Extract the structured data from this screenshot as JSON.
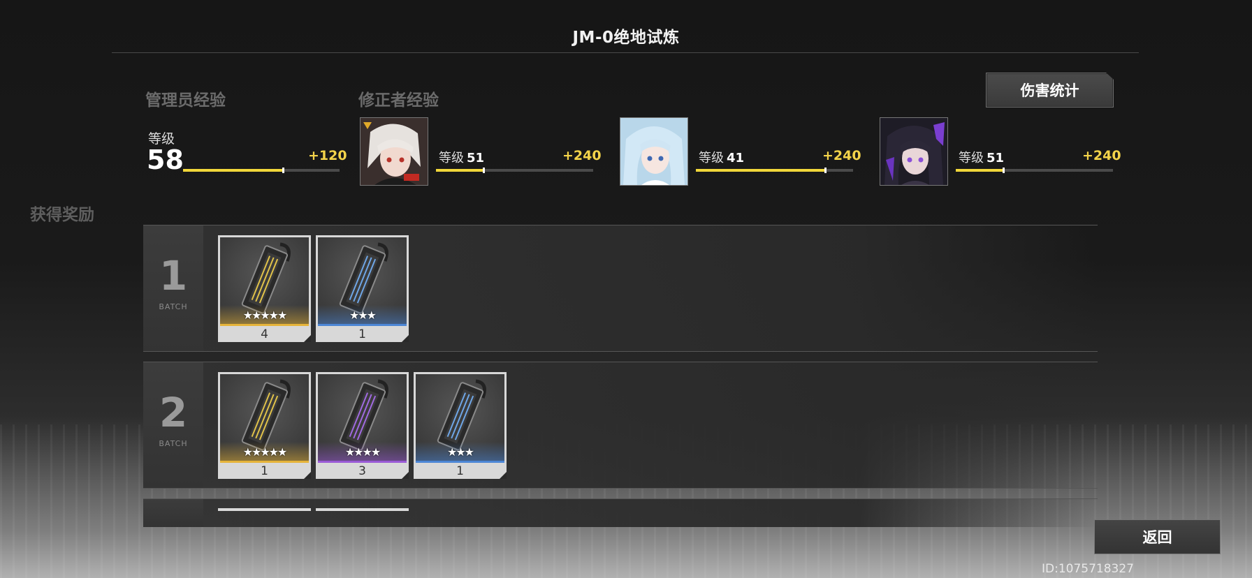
{
  "header": {
    "title": "JM-0绝地试炼"
  },
  "damage_stats_button": "伤害统计",
  "admin": {
    "section_label": "管理员经验",
    "level_label": "等级",
    "level": "58",
    "exp_gain": "+120",
    "progress": 0.64
  },
  "modifiers": {
    "section_label": "修正者经验",
    "characters": [
      {
        "level_label": "等级",
        "level": "51",
        "exp_gain": "+240",
        "progress": 0.3
      },
      {
        "level_label": "等级",
        "level": "41",
        "exp_gain": "+240",
        "progress": 0.82
      },
      {
        "level_label": "等级",
        "level": "51",
        "exp_gain": "+240",
        "progress": 0.3
      }
    ]
  },
  "rewards": {
    "section_label": "获得奖励",
    "batch_word": "BATCH",
    "batches": [
      {
        "number": "1",
        "items": [
          {
            "stars": "★★★★★",
            "count": "4",
            "rarity_color": "#e6b43a"
          },
          {
            "stars": "★★★",
            "count": "1",
            "rarity_color": "#4c86d6"
          }
        ]
      },
      {
        "number": "2",
        "items": [
          {
            "stars": "★★★★★",
            "count": "1",
            "rarity_color": "#e6b43a"
          },
          {
            "stars": "★★★★",
            "count": "3",
            "rarity_color": "#9a5ad6"
          },
          {
            "stars": "★★★",
            "count": "1",
            "rarity_color": "#4c86d6"
          }
        ]
      }
    ]
  },
  "back_button": "返回",
  "player_id": "ID:1075718327"
}
